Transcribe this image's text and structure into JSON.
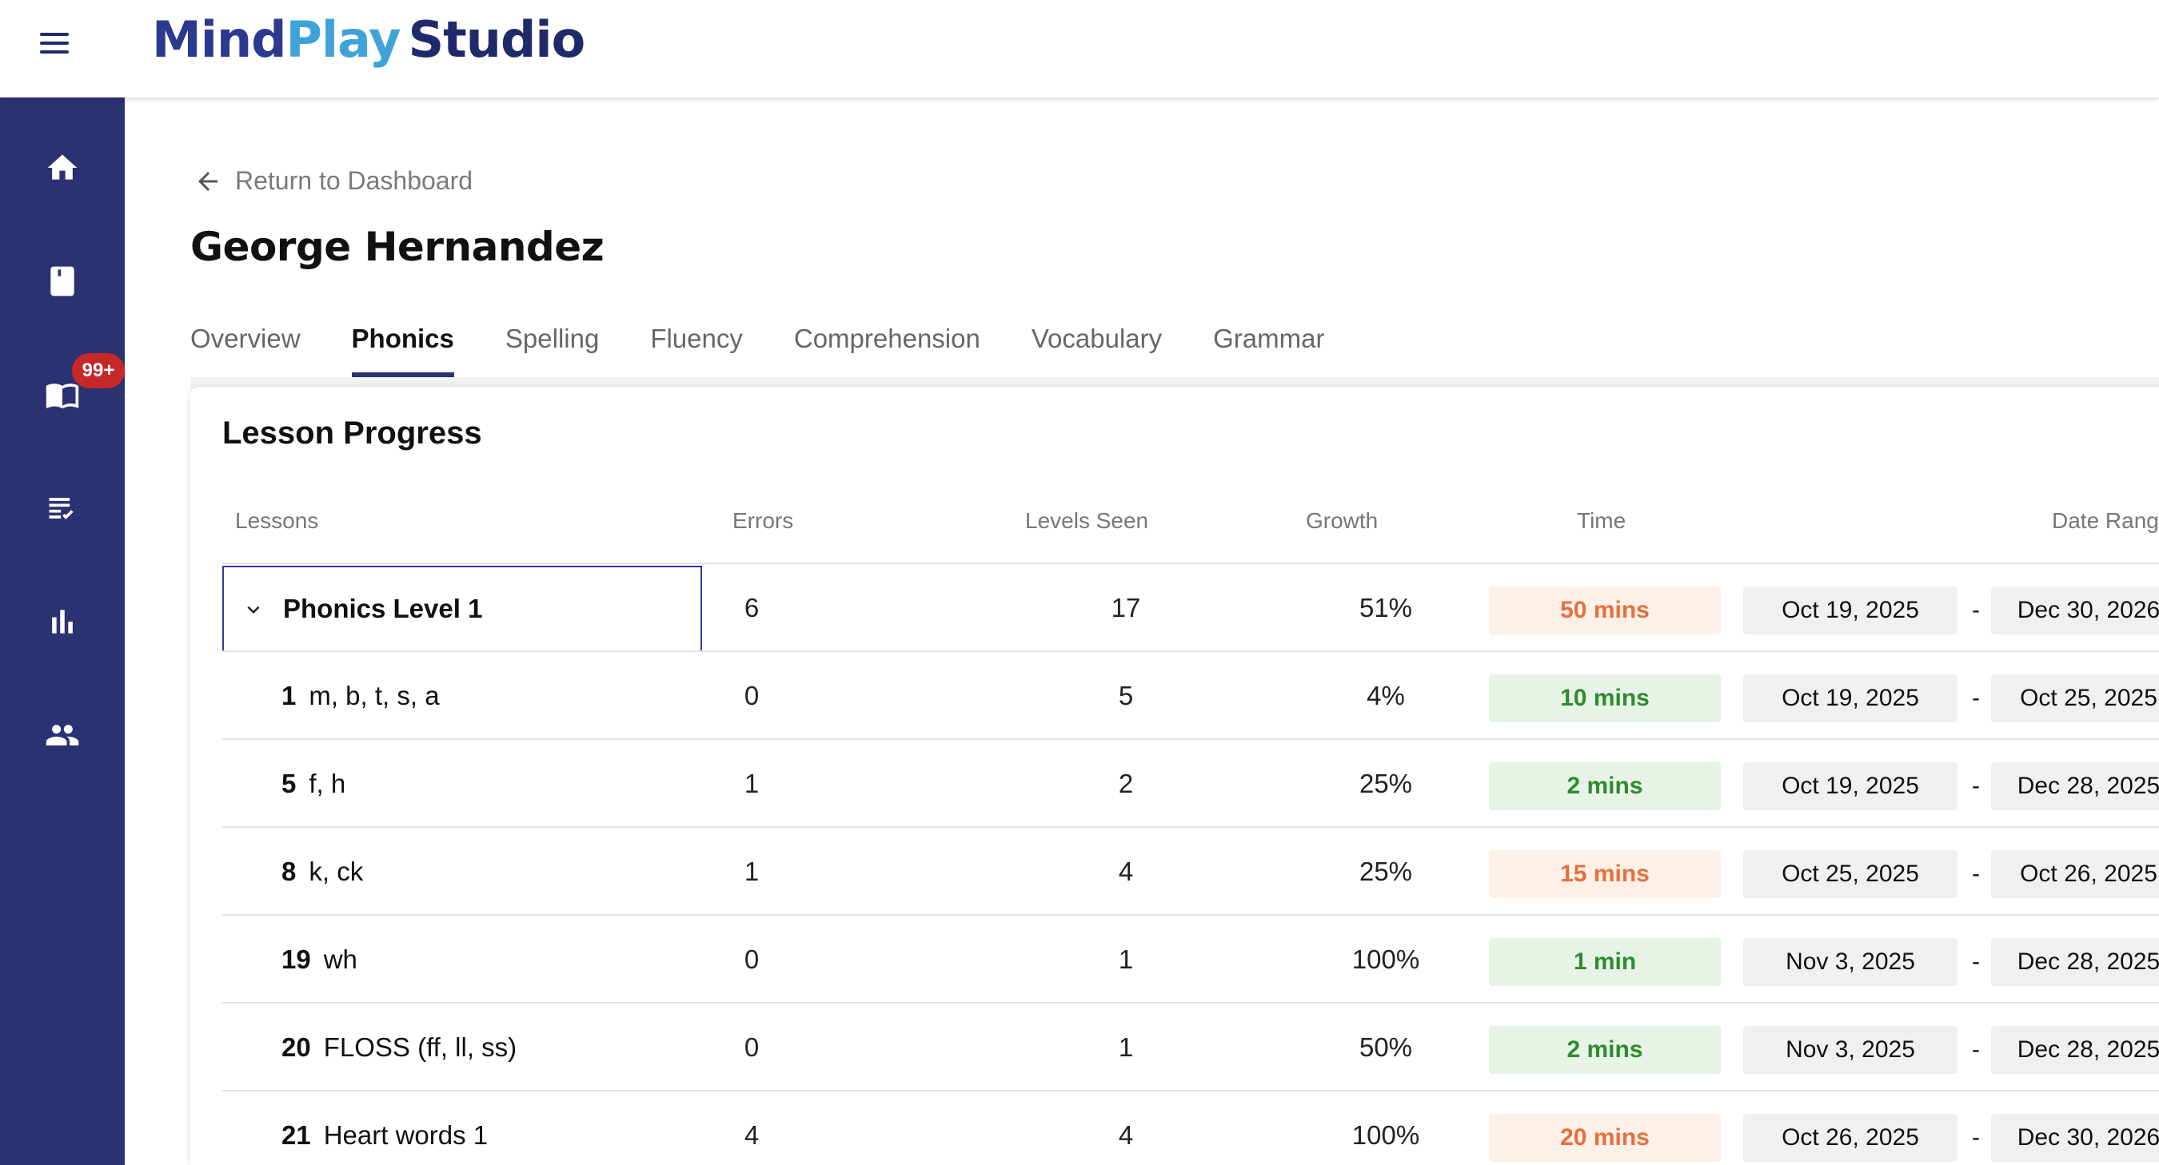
{
  "app": {
    "logo_mind": "Mind",
    "logo_play": "Play",
    "logo_studio": "Studio"
  },
  "sidebar": {
    "items": [
      {
        "icon": "home-icon"
      },
      {
        "icon": "book-icon"
      },
      {
        "icon": "reading-icon"
      },
      {
        "icon": "assignments-icon",
        "badge": "99+"
      },
      {
        "icon": "bar-chart-icon"
      },
      {
        "icon": "people-icon"
      }
    ],
    "badge": "99+"
  },
  "header": {
    "back_label": "Return to Dashboard",
    "student_name": "George Hernandez"
  },
  "tabs": [
    {
      "label": "Overview"
    },
    {
      "label": "Phonics",
      "active": true
    },
    {
      "label": "Spelling"
    },
    {
      "label": "Fluency"
    },
    {
      "label": "Comprehension"
    },
    {
      "label": "Vocabulary"
    },
    {
      "label": "Grammar"
    }
  ],
  "card": {
    "title": "Lesson Progress",
    "columns": {
      "lessons": "Lessons",
      "errors": "Errors",
      "levels_seen": "Levels Seen",
      "growth": "Growth",
      "time": "Time",
      "date_range": "Date Range"
    },
    "group": {
      "label": "Phonics Level 1",
      "errors": "6",
      "levels_seen": "17",
      "growth": "51%",
      "time": "50 mins",
      "time_status": "warn",
      "date_start": "Oct 19, 2025",
      "date_end": "Dec 30, 2026"
    },
    "rows": [
      {
        "num": "1",
        "name": "m, b, t, s, a",
        "errors": "0",
        "levels_seen": "5",
        "growth": "4%",
        "time": "10 mins",
        "time_status": "good",
        "date_start": "Oct 19, 2025",
        "date_end": "Oct 25, 2025"
      },
      {
        "num": "5",
        "name": "f, h",
        "errors": "1",
        "levels_seen": "2",
        "growth": "25%",
        "time": "2 mins",
        "time_status": "good",
        "date_start": "Oct 19, 2025",
        "date_end": "Dec 28, 2025"
      },
      {
        "num": "8",
        "name": "k, ck",
        "errors": "1",
        "levels_seen": "4",
        "growth": "25%",
        "time": "15 mins",
        "time_status": "warn",
        "date_start": "Oct 25, 2025",
        "date_end": "Oct 26, 2025"
      },
      {
        "num": "19",
        "name": "wh",
        "errors": "0",
        "levels_seen": "1",
        "growth": "100%",
        "time": "1 min",
        "time_status": "good",
        "date_start": "Nov 3, 2025",
        "date_end": "Dec 28, 2025"
      },
      {
        "num": "20",
        "name": "FLOSS (ff, ll, ss)",
        "errors": "0",
        "levels_seen": "1",
        "growth": "50%",
        "time": "2 mins",
        "time_status": "good",
        "date_start": "Nov 3, 2025",
        "date_end": "Dec 28, 2025"
      },
      {
        "num": "21",
        "name": "Heart words 1",
        "errors": "4",
        "levels_seen": "4",
        "growth": "100%",
        "time": "20 mins",
        "time_status": "warn",
        "date_start": "Oct 26, 2025",
        "date_end": "Dec 30, 2026"
      }
    ]
  },
  "colors": {
    "sidebar_bg": "#2b3272",
    "accent": "#2f3b9e",
    "error_red": "#c62828",
    "warn_orange": "#e6703a",
    "good_green": "#2e8b2e"
  }
}
